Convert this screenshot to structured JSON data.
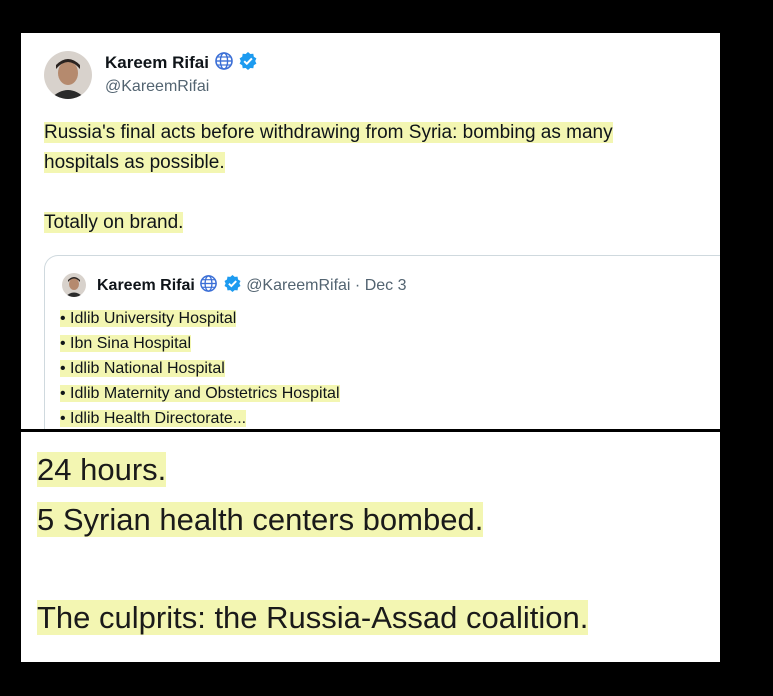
{
  "tweet": {
    "author_name": "Kareem Rifai",
    "author_handle": "@KareemRifai",
    "text_para1_line1": "Russia's final acts before withdrawing from Syria: bombing as many",
    "text_para1_line2": "hospitals as possible.",
    "text_para2": "Totally on brand.",
    "icons": [
      "globe-icon",
      "verified-badge-icon"
    ],
    "verified_color": "#1d9bf0"
  },
  "quoted_tweet": {
    "author_name": "Kareem Rifai",
    "author_handle": "@KareemRifai",
    "separator": "·",
    "date": "Dec 3",
    "items": [
      "• Idlib University Hospital",
      "• Ibn Sina Hospital",
      "• Idlib National Hospital",
      "• Idlib Maternity and Obstetrics Hospital",
      "• Idlib Health Directorate..."
    ]
  },
  "caption": {
    "line1": "24 hours.",
    "line2": "5 Syrian health centers bombed.",
    "line3": "The culprits: the Russia-Assad coalition.",
    "highlight_color": "#f3f6b2"
  }
}
